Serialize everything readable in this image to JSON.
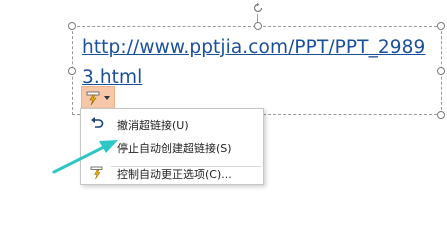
{
  "hyperlink": {
    "text": "http://www.pptjia.com/PPT/PPT_29893.html"
  },
  "menu": {
    "items": [
      {
        "label": "撤消超链接(U)",
        "icon": "undo-icon"
      },
      {
        "label": "停止自动创建超链接(S)",
        "icon": "none"
      },
      {
        "label": "控制自动更正选项(C)...",
        "icon": "autocorrect-options-icon"
      }
    ]
  },
  "colors": {
    "link": "#1a4f9c",
    "button_bg": "#f6c7a8",
    "arrow": "#2ec6c6"
  }
}
